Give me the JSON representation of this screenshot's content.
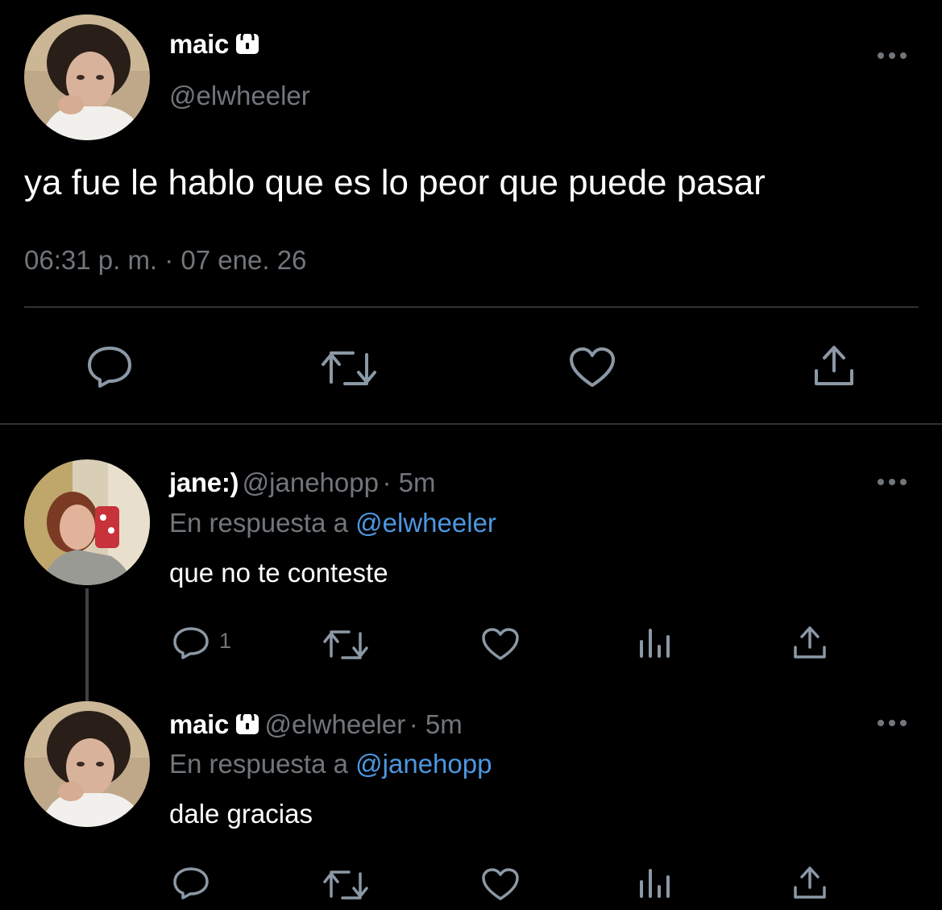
{
  "main_tweet": {
    "display_name": "maic",
    "handle": "@elwheeler",
    "text": "ya fue le hablo que es lo peor que puede pasar",
    "timestamp": "06:31 p. m. · 07 ene. 26",
    "locked": true,
    "actions": [
      "reply-icon",
      "retweet-icon",
      "like-icon",
      "share-icon"
    ]
  },
  "replies": [
    {
      "display_name": "jane:)",
      "handle": "@janehopp",
      "meta": "· 5m",
      "reply_prefix": "En respuesta a",
      "reply_to": "@elwheeler",
      "text": "que no te conteste",
      "reply_count": "1",
      "locked": false
    },
    {
      "display_name": "maic",
      "handle": "@elwheeler",
      "meta": "· 5m",
      "reply_prefix": "En respuesta a",
      "reply_to": "@janehopp",
      "text": "dale gracias",
      "reply_count": "",
      "locked": true
    }
  ],
  "colors": {
    "background": "#000000",
    "text": "#ffffff",
    "muted": "#71767b",
    "link": "#4d97e0",
    "divider": "#2f3336"
  }
}
